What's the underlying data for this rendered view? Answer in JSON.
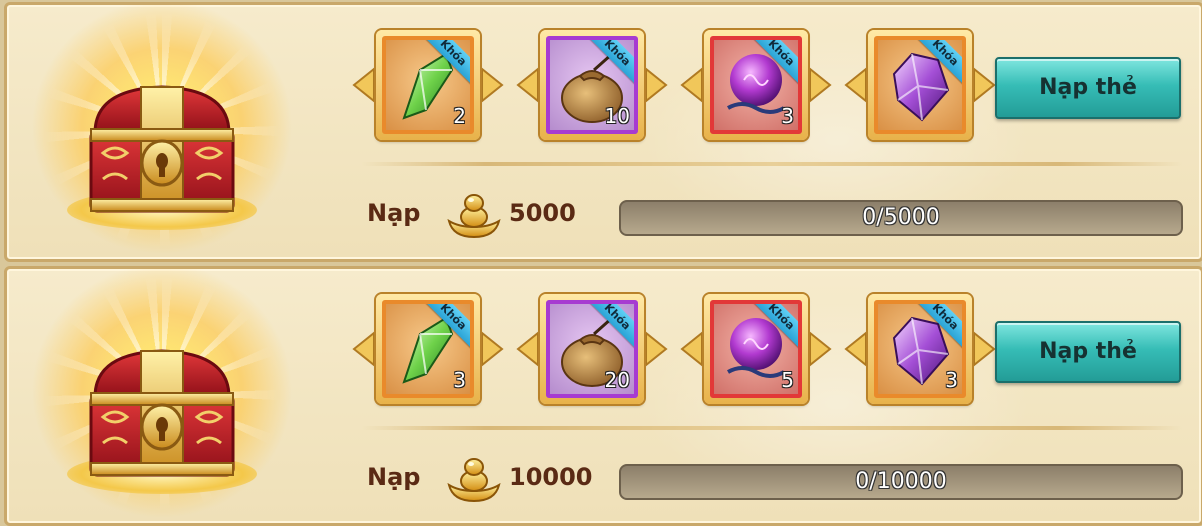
{
  "lock_label": "Khóa",
  "colors": {
    "panel_bg": "#f6ebcc",
    "button_teal": "#36bdb6",
    "text_brown": "#5a2a14",
    "border_orange": "#e98a2b",
    "border_purple": "#a73bd1",
    "border_red": "#e23838"
  },
  "tiers": [
    {
      "items": [
        {
          "icon": "green-crystal-icon",
          "rarity": "orange",
          "qty": "2",
          "locked": true
        },
        {
          "icon": "money-bag-icon",
          "rarity": "purple",
          "qty": "10",
          "locked": true
        },
        {
          "icon": "purple-orb-icon",
          "rarity": "red",
          "qty": "3",
          "locked": true
        },
        {
          "icon": "purple-gem-icon",
          "rarity": "orange",
          "qty": "",
          "locked": true
        }
      ],
      "button_label": "Nạp thẻ",
      "requirement_label": "Nạp",
      "amount": "5000",
      "progress_text": "0/5000",
      "progress_fraction": 0
    },
    {
      "items": [
        {
          "icon": "green-crystal-icon",
          "rarity": "orange",
          "qty": "3",
          "locked": true
        },
        {
          "icon": "money-bag-icon",
          "rarity": "purple",
          "qty": "20",
          "locked": true
        },
        {
          "icon": "purple-orb-icon",
          "rarity": "red",
          "qty": "5",
          "locked": true
        },
        {
          "icon": "purple-gem-icon",
          "rarity": "orange",
          "qty": "3",
          "locked": true
        }
      ],
      "button_label": "Nạp thẻ",
      "requirement_label": "Nạp",
      "amount": "10000",
      "progress_text": "0/10000",
      "progress_fraction": 0
    }
  ]
}
